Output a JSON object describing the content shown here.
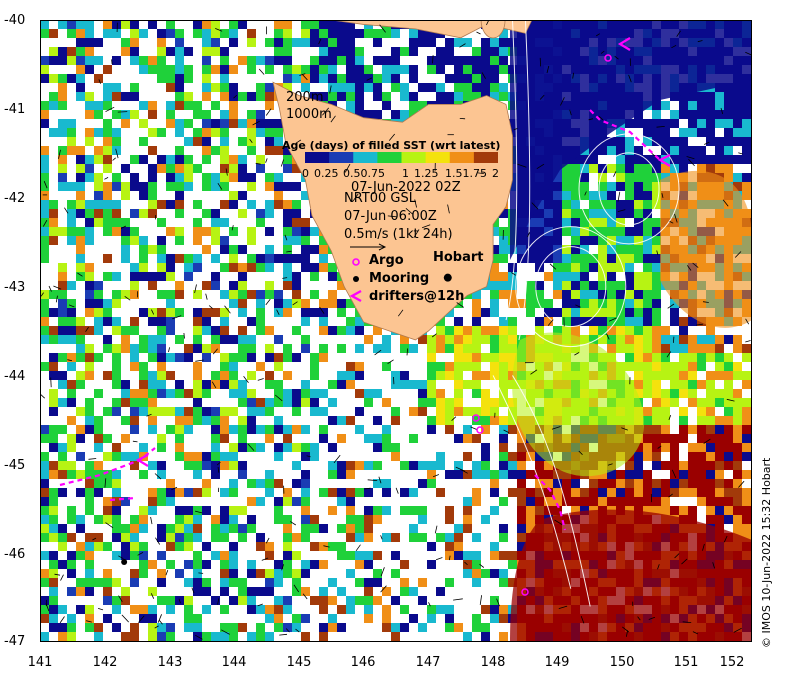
{
  "map": {
    "lon_range": [
      141,
      152
    ],
    "lat_range": [
      -47,
      -40
    ],
    "x_ticks": [
      "141",
      "142",
      "143",
      "144",
      "145",
      "146",
      "147",
      "148",
      "149",
      "150",
      "151",
      "152"
    ],
    "y_ticks": [
      "-40",
      "-41",
      "-42",
      "-43",
      "-44",
      "-45",
      "-46",
      "-47"
    ],
    "colors": {
      "land": "#fcc592",
      "deep_blue": "#0a0a8c",
      "mid_blue": "#1a3cb4",
      "cyan": "#19b9cf",
      "green": "#1fd13a",
      "lime": "#b7f313",
      "yellow": "#f4e20d",
      "orange": "#f08f17",
      "brown": "#a23a0a",
      "darkred": "#9a0000",
      "contour": "#ffffff",
      "argo": "#ff00ff",
      "driftwood": "#ff00ff",
      "mooring": "#000000"
    }
  },
  "labels": {
    "depth_200": "200m",
    "depth_1000": "1000m",
    "colorbar_title": "Age (days) of filled SST (wrt latest)",
    "colorbar_ticks": [
      "0",
      "0.25",
      "0.50.75",
      "1",
      "1.25",
      "1.51.75",
      "2"
    ],
    "sst_date": "07-Jun-2022 02Z",
    "current_source": "NRT00 GSL",
    "current_date": "07-Jun 06:00Z",
    "vector_scale": "0.5m/s (1kt 24h)",
    "argo_label": "Argo",
    "mooring_label": "Mooring",
    "drifters_label": "drifters@12h",
    "hobart_label": "Hobart",
    "credit": "© IMOS 10-Jun-2022 15:32 Hobart"
  }
}
